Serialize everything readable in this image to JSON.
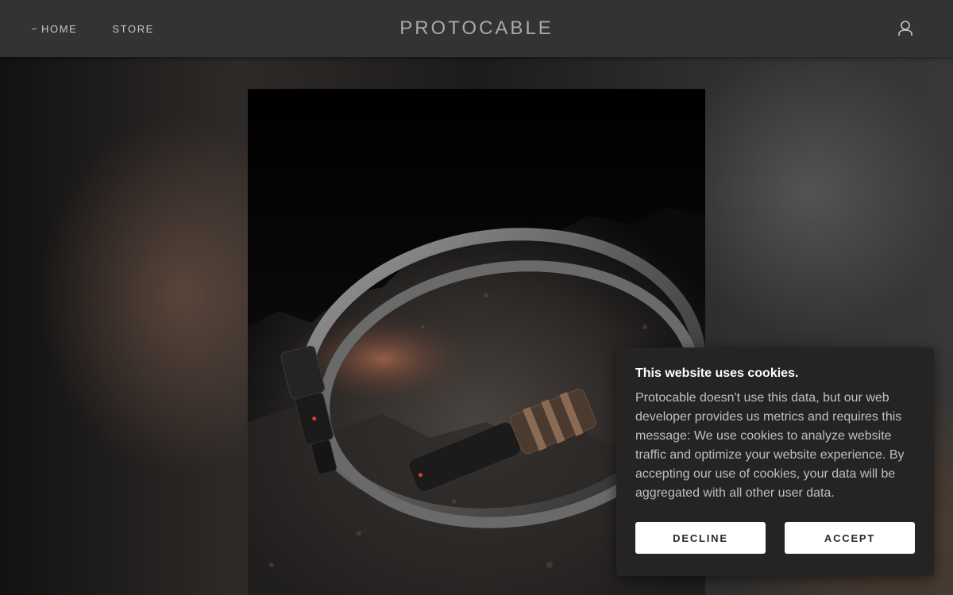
{
  "header": {
    "nav": [
      {
        "label": "HOME",
        "active": true
      },
      {
        "label": "STORE",
        "active": false
      }
    ],
    "brand": "PROTOCABLE",
    "account_icon": "user-icon"
  },
  "hero": {
    "image_subject": "coiled cable with connectors on rock"
  },
  "cookie_banner": {
    "title": "This website uses cookies.",
    "body": "Protocable doesn't use this data, but our web developer provides us metrics and requires this message: We use cookies to analyze website traffic and optimize your website experience. By accepting our use of cookies, your data will be aggregated with all other user data.",
    "decline_label": "DECLINE",
    "accept_label": "ACCEPT"
  },
  "colors": {
    "header_bg": "#333333",
    "banner_bg": "#252423",
    "button_bg": "#ffffff",
    "brand_text": "#a9a9a9"
  }
}
